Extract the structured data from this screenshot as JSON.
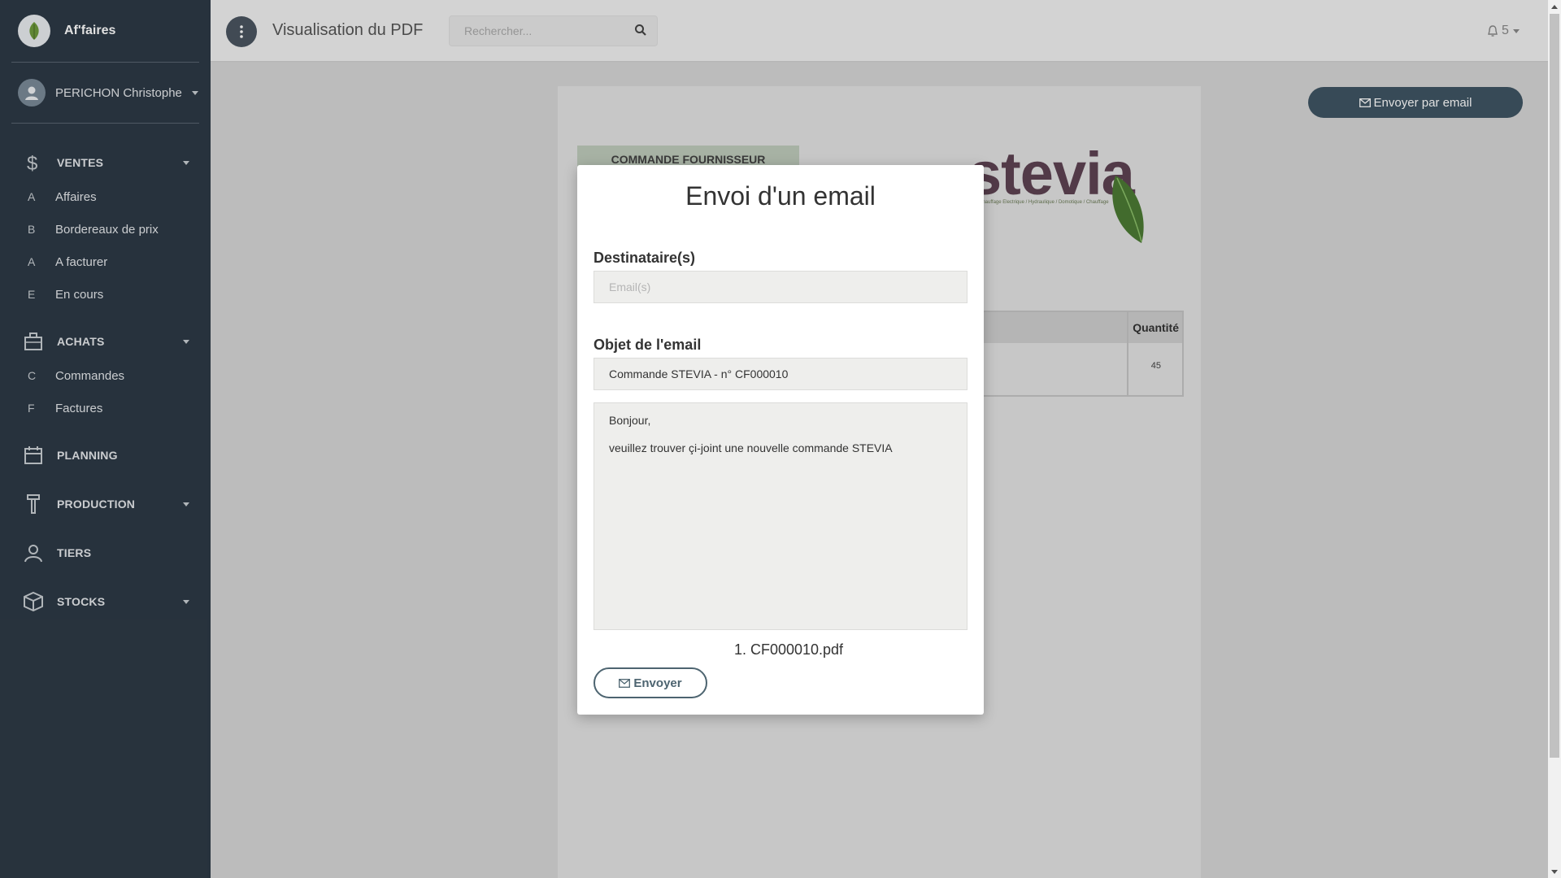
{
  "app": {
    "brand_name": "Af'faires"
  },
  "sidebar": {
    "user_name": "PERICHON Christophe",
    "sections": {
      "ventes": {
        "label": "VENTES",
        "items": [
          {
            "letter": "A",
            "label": "Affaires"
          },
          {
            "letter": "B",
            "label": "Bordereaux de prix"
          },
          {
            "letter": "A",
            "label": "A facturer"
          },
          {
            "letter": "E",
            "label": "En cours"
          }
        ]
      },
      "achats": {
        "label": "ACHATS",
        "items": [
          {
            "letter": "C",
            "label": "Commandes"
          },
          {
            "letter": "F",
            "label": "Factures"
          }
        ]
      },
      "planning": {
        "label": "PLANNING"
      },
      "production": {
        "label": "PRODUCTION"
      },
      "tiers": {
        "label": "TIERS"
      },
      "stocks": {
        "label": "STOCKS"
      }
    }
  },
  "header": {
    "title": "Visualisation du PDF",
    "search_placeholder": "Rechercher...",
    "notifications_count": "5"
  },
  "main": {
    "email_button_label": "Envoyer par email",
    "pdf": {
      "doc_type": "COMMANDE FOURNISSEUR",
      "logo_text": "stevia",
      "logo_tagline": "Chauffage Electrique / Hydraulique / Domotique / Chauffage",
      "table_header": "Quantité",
      "quantity": "45"
    }
  },
  "modal": {
    "title": "Envoi d'un email",
    "recipients_label": "Destinataire(s)",
    "recipients_placeholder": "Email(s)",
    "recipients_value": "",
    "subject_label": "Objet de l'email",
    "subject_value": "Commande STEVIA - n° CF000010",
    "body_lines": [
      "Bonjour,",
      "veuillez trouver çi-joint une nouvelle commande STEVIA"
    ],
    "attachment": "1. CF000010.pdf",
    "send_label": "Envoyer"
  }
}
